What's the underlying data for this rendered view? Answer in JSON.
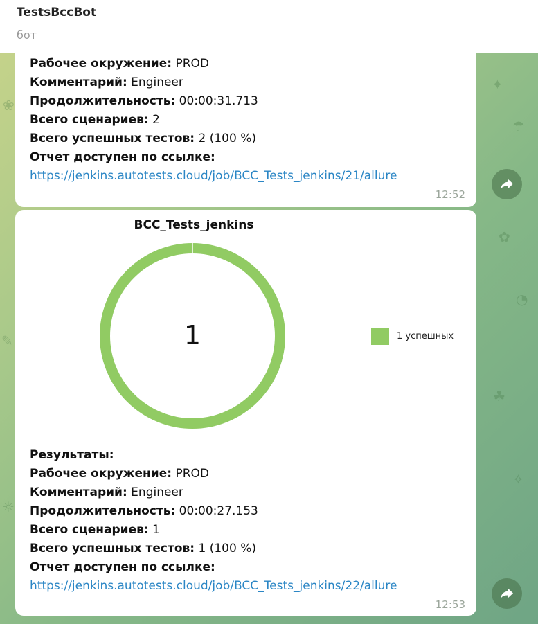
{
  "header": {
    "title": "TestsBccBot",
    "subtitle": "бот"
  },
  "messages": [
    {
      "lines": [
        {
          "label": "Рабочее окружение:",
          "value": "PROD"
        },
        {
          "label": "Комментарий:",
          "value": "Engineer"
        },
        {
          "label": "Продолжительность:",
          "value": "00:00:31.713"
        },
        {
          "label": "Всего сценариев:",
          "value": "2"
        },
        {
          "label": "Всего успешных тестов:",
          "value": "2 (100 %)"
        },
        {
          "label": "Отчет доступен по ссылке:",
          "value": ""
        }
      ],
      "link": "https://jenkins.autotests.cloud/job/BCC_Tests_jenkins/21/allure",
      "time": "12:52"
    },
    {
      "heading": "Результаты:",
      "lines": [
        {
          "label": "Рабочее окружение:",
          "value": "PROD"
        },
        {
          "label": "Комментарий:",
          "value": "Engineer"
        },
        {
          "label": "Продолжительность:",
          "value": "00:00:27.153"
        },
        {
          "label": "Всего сценариев:",
          "value": "1"
        },
        {
          "label": "Всего успешных тестов:",
          "value": "1 (100 %)"
        },
        {
          "label": "Отчет доступен по ссылке:",
          "value": ""
        }
      ],
      "link": "https://jenkins.autotests.cloud/job/BCC_Tests_jenkins/22/allure",
      "time": "12:53"
    }
  ],
  "chart_data": {
    "type": "pie",
    "title": "BCC_Tests_jenkins",
    "center_label": "1",
    "categories": [
      "1 успешных"
    ],
    "values": [
      1
    ],
    "colors": [
      "#91cb63"
    ],
    "legend_position": "right"
  },
  "icons": {
    "forward": "forward-arrow-icon"
  },
  "colors": {
    "link": "#2b86c5",
    "success": "#91cb63"
  }
}
